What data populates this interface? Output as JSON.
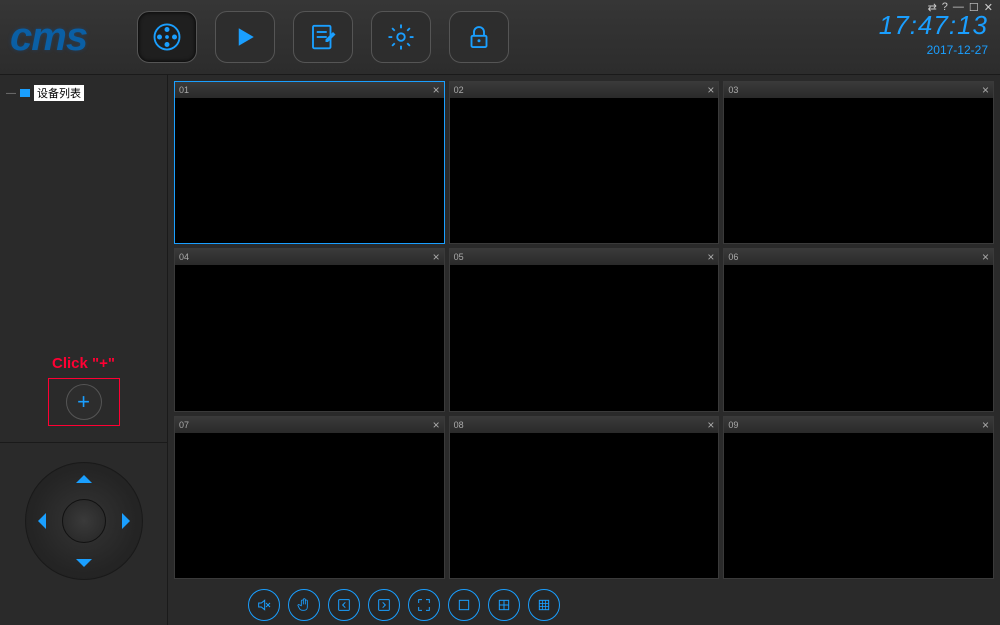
{
  "app": {
    "logo_text": "cms"
  },
  "clock": {
    "time": "17:47:13",
    "date": "2017-12-27"
  },
  "window_controls": {
    "swap": "⇄",
    "help": "?",
    "minimize": "—",
    "maximize": "☐",
    "close": "✕"
  },
  "top_nav": {
    "items": [
      {
        "name": "preview",
        "active": true
      },
      {
        "name": "playback",
        "active": false
      },
      {
        "name": "log",
        "active": false
      },
      {
        "name": "settings",
        "active": false
      },
      {
        "name": "lock",
        "active": false
      }
    ]
  },
  "sidebar": {
    "device_list_label": "设备列表",
    "add_hint": "Click \"+\""
  },
  "channels": [
    {
      "label": "01",
      "active": true
    },
    {
      "label": "02",
      "active": false
    },
    {
      "label": "03",
      "active": false
    },
    {
      "label": "04",
      "active": false
    },
    {
      "label": "05",
      "active": false
    },
    {
      "label": "06",
      "active": false
    },
    {
      "label": "07",
      "active": false
    },
    {
      "label": "08",
      "active": false
    },
    {
      "label": "09",
      "active": false
    }
  ],
  "bottom_toolbar": {
    "items": [
      "mute",
      "manual",
      "prev-page",
      "next-page",
      "fullscreen",
      "layout-1",
      "layout-4",
      "layout-9"
    ]
  },
  "colors": {
    "accent": "#1a9fff"
  }
}
